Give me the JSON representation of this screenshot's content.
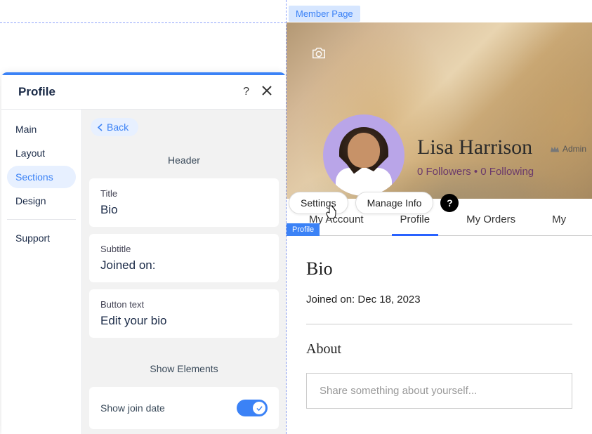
{
  "page_tag": "Member Page",
  "panel": {
    "title": "Profile",
    "nav": {
      "main": "Main",
      "layout": "Layout",
      "sections": "Sections",
      "design": "Design",
      "support": "Support"
    },
    "back_label": "Back",
    "header_section_label": "Header",
    "fields": {
      "title": {
        "label": "Title",
        "value": "Bio"
      },
      "subtitle": {
        "label": "Subtitle",
        "value": "Joined on:"
      },
      "button_text": {
        "label": "Button text",
        "value": "Edit your bio"
      }
    },
    "show_elements_label": "Show Elements",
    "toggles": {
      "join_date": {
        "label": "Show join date",
        "value": true
      }
    }
  },
  "preview": {
    "name": "Lisa Harrison",
    "admin_label": "Admin",
    "followers_text": "0 Followers • 0 Following",
    "pills": {
      "settings": "Settings",
      "manage_info": "Manage Info"
    },
    "tabs": {
      "account": "My Account",
      "profile": "Profile",
      "orders": "My Orders",
      "more": "My"
    },
    "mini_tag": "Profile",
    "bio_heading": "Bio",
    "joined_text": "Joined on: Dec 18, 2023",
    "about_heading": "About",
    "about_placeholder": "Share something about yourself..."
  }
}
